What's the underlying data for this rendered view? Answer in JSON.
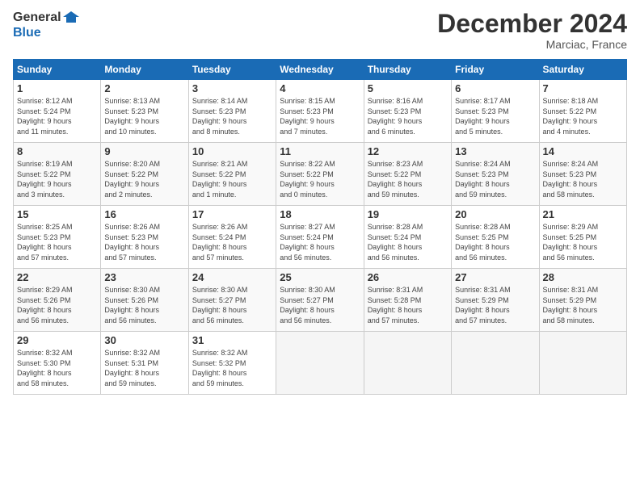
{
  "logo": {
    "line1": "General",
    "line2": "Blue"
  },
  "title": "December 2024",
  "location": "Marciac, France",
  "days_header": [
    "Sunday",
    "Monday",
    "Tuesday",
    "Wednesday",
    "Thursday",
    "Friday",
    "Saturday"
  ],
  "weeks": [
    [
      {
        "num": "1",
        "info": "Sunrise: 8:12 AM\nSunset: 5:24 PM\nDaylight: 9 hours\nand 11 minutes."
      },
      {
        "num": "2",
        "info": "Sunrise: 8:13 AM\nSunset: 5:23 PM\nDaylight: 9 hours\nand 10 minutes."
      },
      {
        "num": "3",
        "info": "Sunrise: 8:14 AM\nSunset: 5:23 PM\nDaylight: 9 hours\nand 8 minutes."
      },
      {
        "num": "4",
        "info": "Sunrise: 8:15 AM\nSunset: 5:23 PM\nDaylight: 9 hours\nand 7 minutes."
      },
      {
        "num": "5",
        "info": "Sunrise: 8:16 AM\nSunset: 5:23 PM\nDaylight: 9 hours\nand 6 minutes."
      },
      {
        "num": "6",
        "info": "Sunrise: 8:17 AM\nSunset: 5:23 PM\nDaylight: 9 hours\nand 5 minutes."
      },
      {
        "num": "7",
        "info": "Sunrise: 8:18 AM\nSunset: 5:22 PM\nDaylight: 9 hours\nand 4 minutes."
      }
    ],
    [
      {
        "num": "8",
        "info": "Sunrise: 8:19 AM\nSunset: 5:22 PM\nDaylight: 9 hours\nand 3 minutes."
      },
      {
        "num": "9",
        "info": "Sunrise: 8:20 AM\nSunset: 5:22 PM\nDaylight: 9 hours\nand 2 minutes."
      },
      {
        "num": "10",
        "info": "Sunrise: 8:21 AM\nSunset: 5:22 PM\nDaylight: 9 hours\nand 1 minute."
      },
      {
        "num": "11",
        "info": "Sunrise: 8:22 AM\nSunset: 5:22 PM\nDaylight: 9 hours\nand 0 minutes."
      },
      {
        "num": "12",
        "info": "Sunrise: 8:23 AM\nSunset: 5:22 PM\nDaylight: 8 hours\nand 59 minutes."
      },
      {
        "num": "13",
        "info": "Sunrise: 8:24 AM\nSunset: 5:23 PM\nDaylight: 8 hours\nand 59 minutes."
      },
      {
        "num": "14",
        "info": "Sunrise: 8:24 AM\nSunset: 5:23 PM\nDaylight: 8 hours\nand 58 minutes."
      }
    ],
    [
      {
        "num": "15",
        "info": "Sunrise: 8:25 AM\nSunset: 5:23 PM\nDaylight: 8 hours\nand 57 minutes."
      },
      {
        "num": "16",
        "info": "Sunrise: 8:26 AM\nSunset: 5:23 PM\nDaylight: 8 hours\nand 57 minutes."
      },
      {
        "num": "17",
        "info": "Sunrise: 8:26 AM\nSunset: 5:24 PM\nDaylight: 8 hours\nand 57 minutes."
      },
      {
        "num": "18",
        "info": "Sunrise: 8:27 AM\nSunset: 5:24 PM\nDaylight: 8 hours\nand 56 minutes."
      },
      {
        "num": "19",
        "info": "Sunrise: 8:28 AM\nSunset: 5:24 PM\nDaylight: 8 hours\nand 56 minutes."
      },
      {
        "num": "20",
        "info": "Sunrise: 8:28 AM\nSunset: 5:25 PM\nDaylight: 8 hours\nand 56 minutes."
      },
      {
        "num": "21",
        "info": "Sunrise: 8:29 AM\nSunset: 5:25 PM\nDaylight: 8 hours\nand 56 minutes."
      }
    ],
    [
      {
        "num": "22",
        "info": "Sunrise: 8:29 AM\nSunset: 5:26 PM\nDaylight: 8 hours\nand 56 minutes."
      },
      {
        "num": "23",
        "info": "Sunrise: 8:30 AM\nSunset: 5:26 PM\nDaylight: 8 hours\nand 56 minutes."
      },
      {
        "num": "24",
        "info": "Sunrise: 8:30 AM\nSunset: 5:27 PM\nDaylight: 8 hours\nand 56 minutes."
      },
      {
        "num": "25",
        "info": "Sunrise: 8:30 AM\nSunset: 5:27 PM\nDaylight: 8 hours\nand 56 minutes."
      },
      {
        "num": "26",
        "info": "Sunrise: 8:31 AM\nSunset: 5:28 PM\nDaylight: 8 hours\nand 57 minutes."
      },
      {
        "num": "27",
        "info": "Sunrise: 8:31 AM\nSunset: 5:29 PM\nDaylight: 8 hours\nand 57 minutes."
      },
      {
        "num": "28",
        "info": "Sunrise: 8:31 AM\nSunset: 5:29 PM\nDaylight: 8 hours\nand 58 minutes."
      }
    ],
    [
      {
        "num": "29",
        "info": "Sunrise: 8:32 AM\nSunset: 5:30 PM\nDaylight: 8 hours\nand 58 minutes."
      },
      {
        "num": "30",
        "info": "Sunrise: 8:32 AM\nSunset: 5:31 PM\nDaylight: 8 hours\nand 59 minutes."
      },
      {
        "num": "31",
        "info": "Sunrise: 8:32 AM\nSunset: 5:32 PM\nDaylight: 8 hours\nand 59 minutes."
      },
      null,
      null,
      null,
      null
    ]
  ]
}
